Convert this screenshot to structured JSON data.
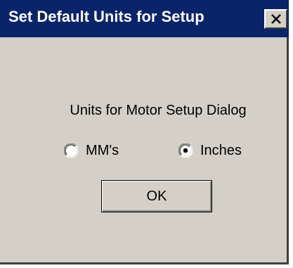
{
  "window": {
    "title": "Set Default Units for Setup",
    "close_icon": "close-icon",
    "colors": {
      "title_bar": "#0a246a",
      "title_text": "#ffffff",
      "face": "#d4d0c8"
    }
  },
  "units_group": {
    "label": "Units for Motor Setup Dialog",
    "options": [
      {
        "label": "MM's",
        "selected": false
      },
      {
        "label": "Inches",
        "selected": true
      }
    ]
  },
  "buttons": {
    "ok_label": "OK"
  }
}
